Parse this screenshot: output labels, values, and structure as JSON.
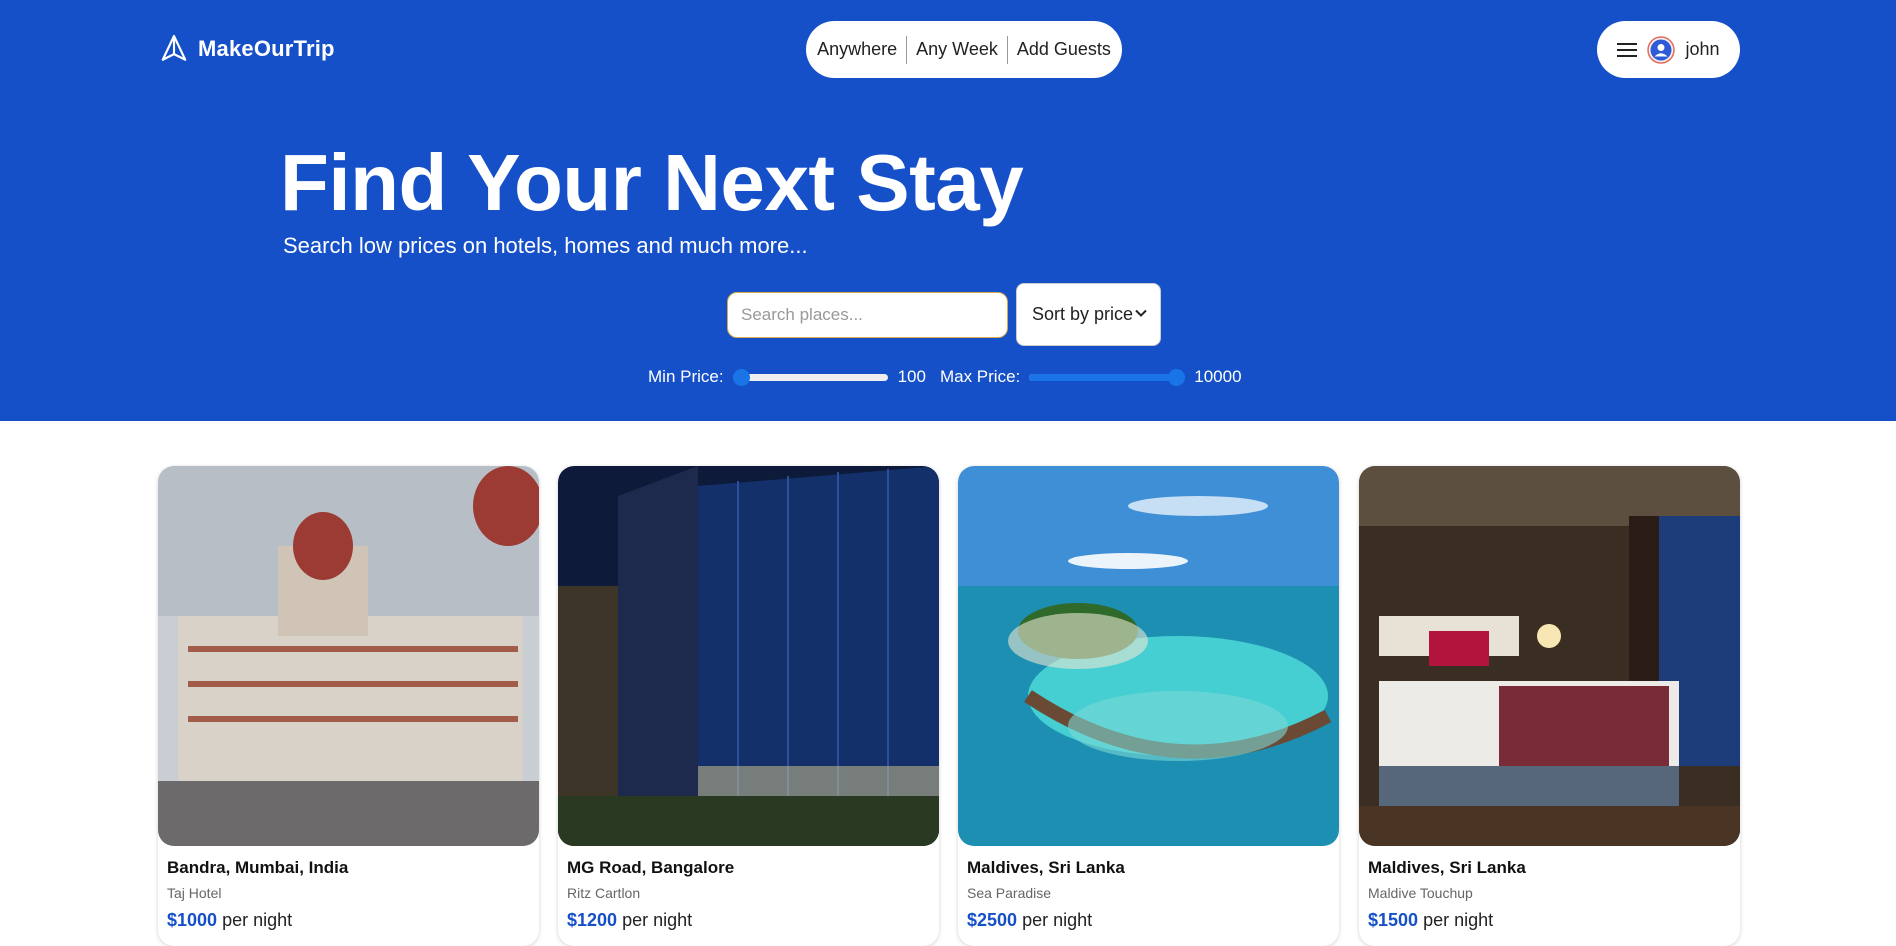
{
  "brand": {
    "name": "MakeOurTrip",
    "logo_icon": "paper-plane-icon"
  },
  "header_search": {
    "where": "Anywhere",
    "when": "Any Week",
    "guests": "Add Guests"
  },
  "user_menu": {
    "menu_icon": "hamburger-icon",
    "avatar_icon": "user-circle-icon",
    "username": "john"
  },
  "hero": {
    "title": "Find Your Next Stay",
    "subtitle": "Search low prices on hotels, homes and much more..."
  },
  "filters": {
    "search_placeholder": "Search places...",
    "sort_label": "Sort by price",
    "min_price_label": "Min Price:",
    "min_price_value": "100",
    "max_price_label": "Max Price:",
    "max_price_value": "10000",
    "min_slider_fraction": 0.0,
    "max_slider_fraction": 1.0
  },
  "listings": [
    {
      "location": "Bandra, Mumbai, India",
      "name": "Taj Hotel",
      "price": "$1000",
      "unit": "per night"
    },
    {
      "location": "MG Road, Bangalore",
      "name": "Ritz Cartlon",
      "price": "$1200",
      "unit": "per night"
    },
    {
      "location": "Maldives, Sri Lanka",
      "name": "Sea Paradise",
      "price": "$2500",
      "unit": "per night"
    },
    {
      "location": "Maldives, Sri Lanka",
      "name": "Maldive Touchup",
      "price": "$1500",
      "unit": "per night"
    }
  ],
  "colors": {
    "primary": "#1550c8",
    "accent": "#1a74e8",
    "card_bg": "#ffffff"
  }
}
